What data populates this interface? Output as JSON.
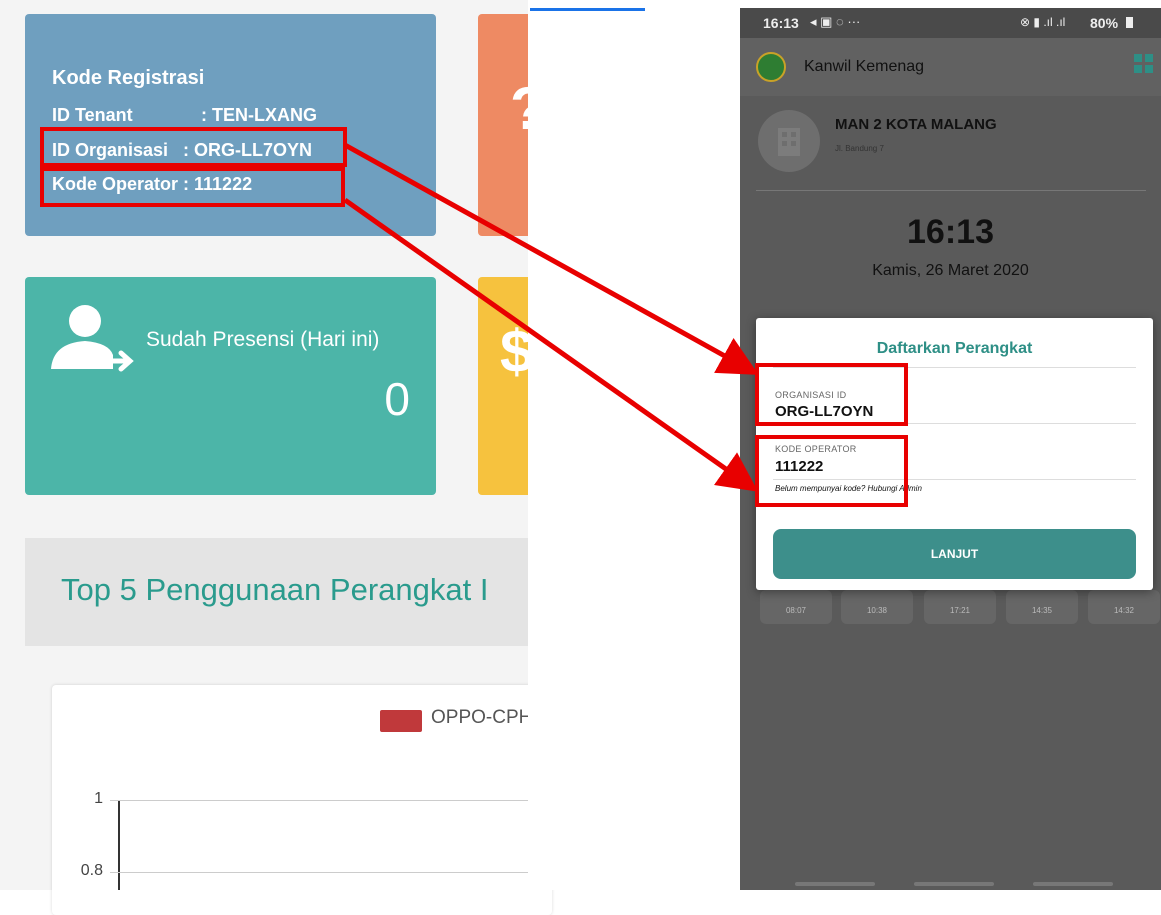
{
  "dashboard": {
    "registration_card": {
      "title": "Kode Registrasi",
      "tenant_label": "ID Tenant",
      "tenant_value": ": TEN-LXANG",
      "org_line": "ID Organisasi   : ORG-LL7OYN",
      "operator_line": "Kode Operator : 111222"
    },
    "presence_card": {
      "label": "Sudah Presensi (Hari ini)",
      "count": "0"
    },
    "section_title": "Top 5 Penggunaan Perangkat I",
    "chart_legend": "OPPO-CPH",
    "chart_ticks": [
      "1",
      "0.8"
    ]
  },
  "phone": {
    "status_time": "16:13",
    "status_right": "80%",
    "app_title": "Kanwil Kemenag",
    "school_name": "MAN 2 KOTA MALANG",
    "school_address": "Jl. Bandung 7",
    "clock": "16:13",
    "date": "Kamis, 26 Maret 2020",
    "attendance_times": [
      "08:07",
      "10:38",
      "17:21",
      "14:35",
      "14:32"
    ],
    "dialog": {
      "title": "Daftarkan Perangkat",
      "org_label": "ORGANISASI ID",
      "org_value": "ORG-LL7OYN",
      "op_label": "KODE OPERATOR",
      "op_value": "111222",
      "hint": "Belum mempunyai kode? Hubungi Admin",
      "button": "LANJUT"
    }
  },
  "colors": {
    "accent_red": "#e80000",
    "teal": "#4cb5a8",
    "blue_card": "#6f9fbf"
  }
}
